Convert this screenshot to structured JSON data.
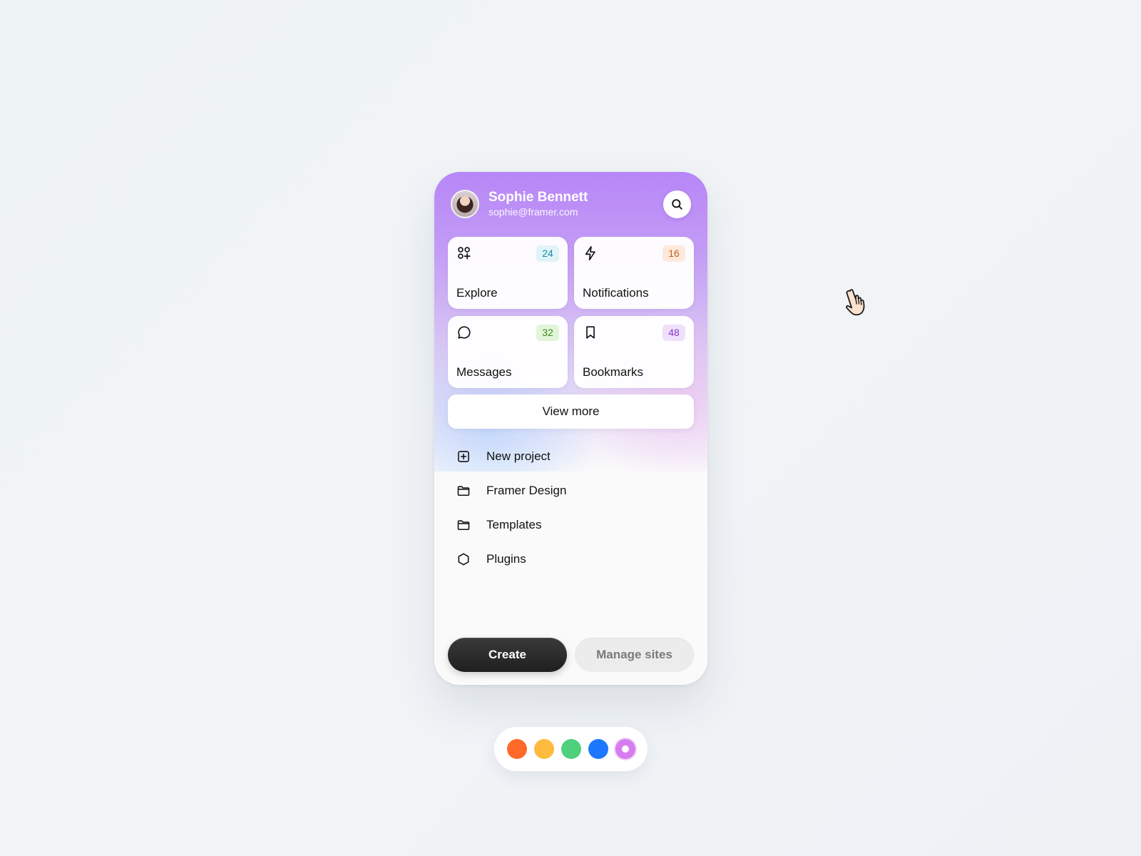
{
  "user": {
    "name": "Sophie Bennett",
    "email": "sophie@framer.com",
    "avatar_icon": "user-avatar"
  },
  "header": {
    "search_icon": "search-icon"
  },
  "tiles": [
    {
      "label": "Explore",
      "count": "24",
      "icon": "apps-icon",
      "badge_bg": "#dff3f8",
      "badge_fg": "#1a8aa6"
    },
    {
      "label": "Notifications",
      "count": "16",
      "icon": "bolt-icon",
      "badge_bg": "#fde9dc",
      "badge_fg": "#c45e1c"
    },
    {
      "label": "Messages",
      "count": "32",
      "icon": "chat-icon",
      "badge_bg": "#e2f5d9",
      "badge_fg": "#3c8a1f"
    },
    {
      "label": "Bookmarks",
      "count": "48",
      "icon": "bookmark-icon",
      "badge_bg": "#efe0fb",
      "badge_fg": "#8a35c9"
    }
  ],
  "view_more_label": "View more",
  "menu": [
    {
      "label": "New project",
      "icon": "plus-square-icon"
    },
    {
      "label": "Framer Design",
      "icon": "folder-icon"
    },
    {
      "label": "Templates",
      "icon": "folder-icon"
    },
    {
      "label": "Plugins",
      "icon": "hexagon-icon"
    }
  ],
  "actions": {
    "create_label": "Create",
    "manage_label": "Manage sites"
  },
  "palette": {
    "colors": [
      "#ff6a2b",
      "#ffbb3d",
      "#4fd07c",
      "#1e78ff",
      "#d67cf0"
    ],
    "selected_index": 4
  },
  "cursor_icon": "hand-pointer-icon"
}
